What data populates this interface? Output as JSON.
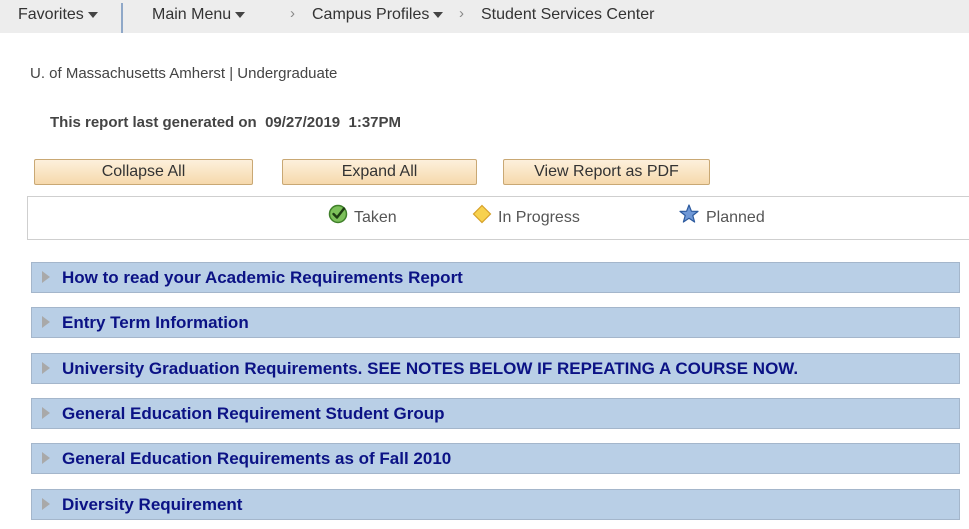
{
  "topbar": {
    "favorites": "Favorites",
    "main_menu": "Main Menu",
    "breadcrumbs": [
      {
        "label": "Campus Profiles",
        "has_dropdown": true
      },
      {
        "label": "Student Services Center",
        "has_dropdown": false
      }
    ],
    "separator_glyph": "›"
  },
  "institution": "U. of Massachusetts Amherst | Undergraduate",
  "report": {
    "generated_label": "This report last generated on",
    "generated_date": "09/27/2019",
    "generated_time": "1:37PM"
  },
  "buttons": {
    "collapse_all": "Collapse All",
    "expand_all": "Expand All",
    "view_pdf": "View Report as PDF"
  },
  "legend": [
    {
      "icon": "check-circle-icon",
      "label": "Taken",
      "color": "#5aa03c"
    },
    {
      "icon": "diamond-icon",
      "label": "In Progress",
      "color": "#f5c842"
    },
    {
      "icon": "star-icon",
      "label": "Planned",
      "color": "#4a78c0"
    }
  ],
  "sections": [
    {
      "title": "How to read your Academic Requirements Report",
      "expanded": false
    },
    {
      "title": "Entry Term Information",
      "expanded": false
    },
    {
      "title": "University Graduation Requirements. SEE NOTES BELOW IF REPEATING A COURSE NOW.",
      "expanded": false
    },
    {
      "title": "General Education Requirement Student Group",
      "expanded": false
    },
    {
      "title": "General Education Requirements as of Fall 2010",
      "expanded": false
    },
    {
      "title": "Diversity Requirement",
      "expanded": false
    }
  ],
  "colors": {
    "section_bg": "#b9cfe6",
    "section_title": "#0b1285",
    "button_bg": "#f6d9ac"
  }
}
